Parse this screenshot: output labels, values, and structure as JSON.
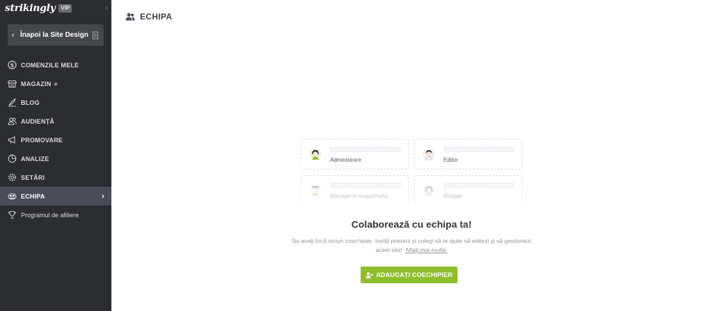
{
  "brand": {
    "logo_text": "strikingly",
    "badge": "VIP"
  },
  "sidebar": {
    "back_label": "Înapoi la Site Design",
    "items": [
      {
        "label": "COMENZILE MELE",
        "icon": "dollar-circle-icon"
      },
      {
        "label": "MAGAZIN",
        "icon": "store-icon",
        "dot": "◆"
      },
      {
        "label": "BLOG",
        "icon": "quill-icon"
      },
      {
        "label": "AUDIENȚĂ",
        "icon": "people-icon"
      },
      {
        "label": "PROMOVARE",
        "icon": "megaphone-icon"
      },
      {
        "label": "ANALIZE",
        "icon": "pie-chart-icon"
      },
      {
        "label": "SETĂRI",
        "icon": "gear-icon"
      },
      {
        "label": "ECHIPA",
        "icon": "team-globe-icon",
        "active": true
      },
      {
        "label": "Programul de afiliere",
        "icon": "trophy-icon"
      }
    ]
  },
  "header": {
    "title": "ECHIPA",
    "icon": "team-icon"
  },
  "team_cards": [
    {
      "role": "Administrare"
    },
    {
      "role": "Editor"
    },
    {
      "role": "Managerul magazinului"
    },
    {
      "role": "Blogger"
    }
  ],
  "empty_state": {
    "headline": "Colaborează cu echipa ta!",
    "description": "Nu aveți încă niciun coechipier. Invită prieteni și colegi să te ajute să editezi și să gestionezi acest site!",
    "learn_more": "Aflați mai multe.",
    "button_label": "ADAUGAȚI COECHIPIER"
  },
  "colors": {
    "sidebar_bg": "#2c2d30",
    "active_item_bg": "#4a4d58",
    "accent_green": "#8fbe2b"
  }
}
